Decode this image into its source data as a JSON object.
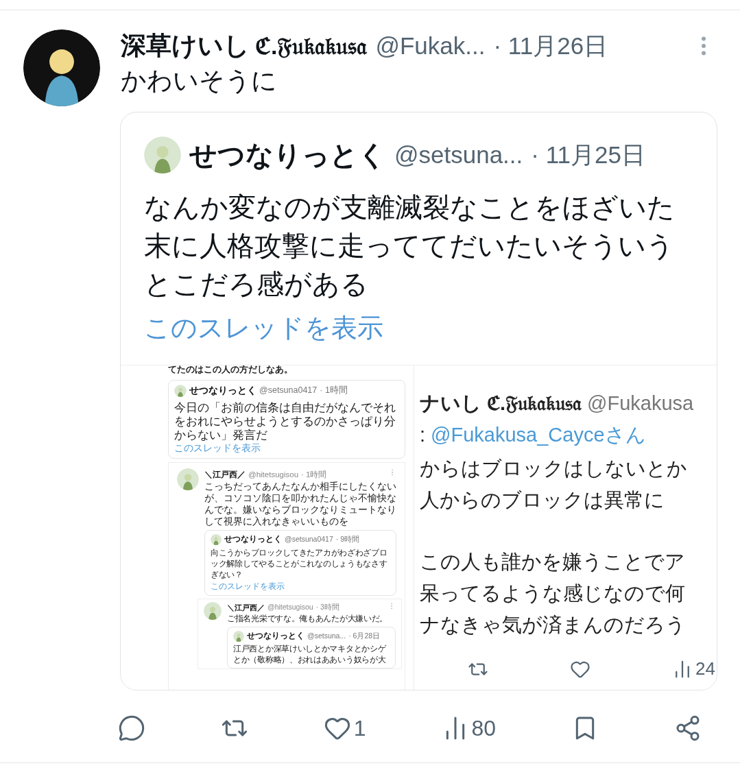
{
  "tweet": {
    "name": "深草けいし",
    "name_suffix": "ℭ.𝔉𝔲𝔨𝔞𝔨𝔲𝔰𝔞",
    "handle": "@Fukak...",
    "date": "· 11月26日",
    "text": "かわいそうに",
    "quote": {
      "name": "せつなりっとく",
      "handle": "@setsuna...",
      "date": "· 11月25日",
      "text": "なんか変なのが支離滅裂なことをほざいた末に人格攻撃に走っててだいたいそういうとこだろ感がある",
      "link": "このスレッドを表示",
      "left_shot": {
        "top_text": "てたのはこの人の方だしなあ。",
        "quote": {
          "name": "せつなりっとく",
          "handle": "@setsuna0417",
          "date": "· 1時間",
          "text": "今日の「お前の信条は自由だがなんでそれをおれにやらせようとするのかさっぱり分からない」発言だ",
          "link": "このスレッドを表示"
        },
        "reply": {
          "name": "＼江戸西／",
          "handle": "@hitetsugisou",
          "date": "· 1時間",
          "text": "こっちだってあんたなんか相手にしたくないが、コソコソ陰口を叩かれたんじゃ不愉快なんでな。嫌いならブロックなりミュートなりして視界に入れなきゃいいものを",
          "quote": {
            "name": "せつなりっとく",
            "handle": "@setsuna0417",
            "date": "· 9時間",
            "text": "向こうからブロックしてきたアカがわざわざブロック解除してやることがこれなのしょうもなさすぎない？",
            "link": "このスレッドを表示"
          },
          "reply": {
            "name": "＼江戸西／",
            "handle": "@hitetsugisou",
            "date": "· 3時間",
            "text": "ご指名光栄ですな。俺もあんたが大嫌いだ。",
            "quote": {
              "name": "せつなりっとく",
              "handle": "@setsuna...",
              "date": "· 6月28日",
              "text": "江戸西とか深草けいしとかマキタとかシゲとか（敬称略）、おれはああいう奴らが大"
            }
          }
        }
      },
      "right_shot": {
        "name": "ナいし",
        "name_suffix": "ℭ.𝔉𝔲𝔨𝔞𝔨𝔲𝔰𝔞",
        "handle": "@Fukakusa",
        "reply_prefix": ":",
        "mention": "@Fukakusa_Cayceさん",
        "paragraphs": [
          [
            "からはブロックはしないとか",
            "人からのブロックは異常に"
          ],
          [
            "この人も誰かを嫌うことでア",
            "呆ってるような感じなので何",
            "ナなきゃ気が済まんのだろう"
          ]
        ],
        "actions": [
          {
            "kind": "retweet"
          },
          {
            "kind": "like"
          },
          {
            "kind": "views",
            "count": "24"
          }
        ]
      }
    },
    "actions": [
      {
        "kind": "reply"
      },
      {
        "kind": "retweet"
      },
      {
        "kind": "like",
        "count": "1"
      },
      {
        "kind": "views",
        "count": "80"
      },
      {
        "kind": "bookmark"
      },
      {
        "kind": "share"
      }
    ]
  }
}
